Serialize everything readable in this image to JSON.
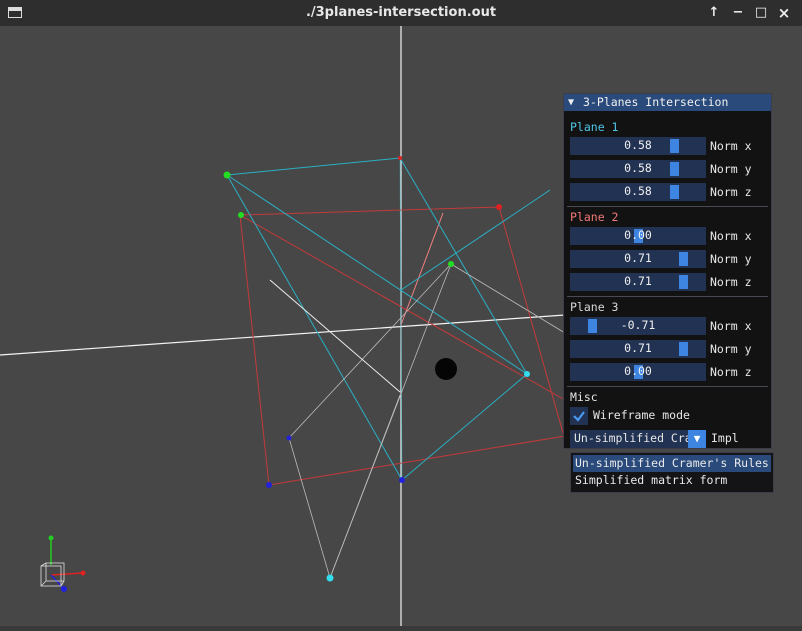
{
  "window": {
    "title": "./3planes-intersection.out",
    "controls": [
      "↑",
      "−",
      "□",
      "×"
    ]
  },
  "panel": {
    "title": "3-Planes Intersection",
    "collapse_glyph": "▼",
    "colors": {
      "plane1": "#4fc6e6",
      "plane2": "#f07878",
      "plane3": "#d8d8d8"
    },
    "plane1": {
      "label": "Plane 1",
      "x": {
        "value": "0.58",
        "label": "Norm x",
        "fraction": 0.79
      },
      "y": {
        "value": "0.58",
        "label": "Norm y",
        "fraction": 0.79
      },
      "z": {
        "value": "0.58",
        "label": "Norm z",
        "fraction": 0.79
      }
    },
    "plane2": {
      "label": "Plane 2",
      "x": {
        "value": "0.00",
        "label": "Norm x",
        "fraction": 0.5
      },
      "y": {
        "value": "0.71",
        "label": "Norm y",
        "fraction": 0.855
      },
      "z": {
        "value": "0.71",
        "label": "Norm z",
        "fraction": 0.855
      }
    },
    "plane3": {
      "label": "Plane 3",
      "x": {
        "value": "-0.71",
        "label": "Norm x",
        "fraction": 0.145
      },
      "y": {
        "value": "0.71",
        "label": "Norm y",
        "fraction": 0.855
      },
      "z": {
        "value": "0.00",
        "label": "Norm z",
        "fraction": 0.5
      }
    },
    "misc": {
      "label": "Misc",
      "wireframe_label": "Wireframe mode",
      "wireframe_checked": true,
      "combo_value": "Un-simplified Cramer's Rules",
      "combo_label": "Impl"
    }
  },
  "dropdown": {
    "options": [
      "Un-simplified Cramer's Rules",
      "Simplified matrix form"
    ],
    "selected_index": 0
  }
}
